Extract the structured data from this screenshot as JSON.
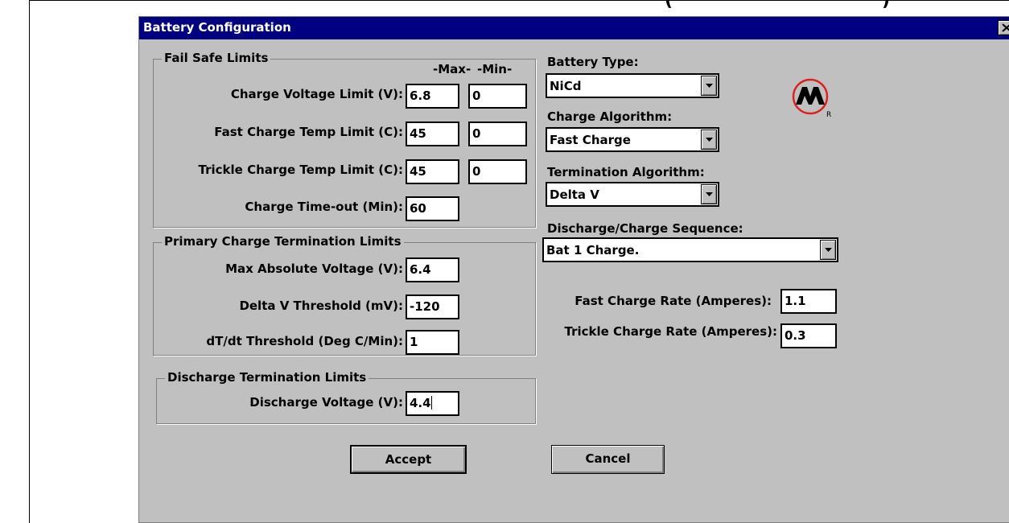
{
  "dialog": {
    "title": "Battery Configuration"
  },
  "failsafe": {
    "title": "Fail Safe Limits",
    "max_header": "-Max-",
    "min_header": "-Min-",
    "rows": [
      {
        "label": "Charge Voltage Limit (V):",
        "max": "6.8",
        "min": "0"
      },
      {
        "label": "Fast Charge Temp Limit (C):",
        "max": "45",
        "min": "0"
      },
      {
        "label": "Trickle Charge Temp Limit (C):",
        "max": "45",
        "min": "0"
      },
      {
        "label": "Charge Time-out (Min):",
        "max": "60"
      }
    ]
  },
  "primary": {
    "title": "Primary Charge Termination Limits",
    "rows": [
      {
        "label": "Max Absolute Voltage (V):",
        "value": "6.4"
      },
      {
        "label": "Delta V Threshold (mV):",
        "value": "-120"
      },
      {
        "label": "dT/dt Threshold (Deg C/Min):",
        "value": "1"
      }
    ]
  },
  "discharge": {
    "title": "Discharge Termination Limits",
    "label": "Discharge Voltage (V):",
    "value": "4.4"
  },
  "right": {
    "battery_type_label": "Battery Type:",
    "battery_type": "NiCd",
    "charge_algorithm_label": "Charge Algorithm:",
    "charge_algorithm": "Fast Charge",
    "termination_label": "Termination Algorithm:",
    "termination": "Delta V",
    "sequence_label": "Discharge/Charge Sequence:",
    "sequence": "Bat 1 Charge.",
    "fast_rate_label": "Fast Charge Rate (Amperes):",
    "fast_rate": "1.1",
    "trickle_rate_label": "Trickle Charge Rate (Amperes):",
    "trickle_rate": "0.3"
  },
  "logo": {
    "icon": "microchip-logo-icon",
    "mark": "R",
    "color": "#e02020"
  },
  "buttons": {
    "accept": "Accept",
    "cancel": "Cancel"
  },
  "icons": {
    "close": "close-icon",
    "dropdown": "dropdown-arrow-icon"
  }
}
